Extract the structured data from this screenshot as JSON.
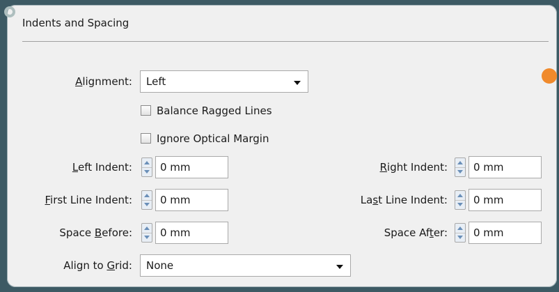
{
  "panel": {
    "title": "Indents and Spacing",
    "alignment": {
      "label_pre": "",
      "label_ul": "A",
      "label_post": "lignment:",
      "value": "Left"
    },
    "balance_ragged": {
      "label": "Balance Ragged Lines",
      "checked": false
    },
    "ignore_optical": {
      "label": "Ignore Optical Margin",
      "checked": false
    },
    "left_indent": {
      "label_pre": "",
      "label_ul": "L",
      "label_post": "eft Indent:",
      "value": "0 mm"
    },
    "right_indent": {
      "label_pre": "",
      "label_ul": "R",
      "label_post": "ight Indent:",
      "value": "0 mm"
    },
    "first_line_indent": {
      "label_pre": "",
      "label_ul": "F",
      "label_post": "irst Line Indent:",
      "value": "0 mm"
    },
    "last_line_indent": {
      "label_pre": "La",
      "label_ul": "s",
      "label_post": "t Line Indent:",
      "value": "0 mm"
    },
    "space_before": {
      "label_pre": "Space ",
      "label_ul": "B",
      "label_post": "efore:",
      "value": "0 mm"
    },
    "space_after": {
      "label_pre": "Space Af",
      "label_ul": "t",
      "label_post": "er:",
      "value": "0 mm"
    },
    "align_grid": {
      "label_pre": "Align to ",
      "label_ul": "G",
      "label_post": "rid:",
      "value": "None"
    }
  },
  "colors": {
    "background": "#3d5a64",
    "panel": "#f0f0f0",
    "accent_dot": "#f08a2c"
  }
}
